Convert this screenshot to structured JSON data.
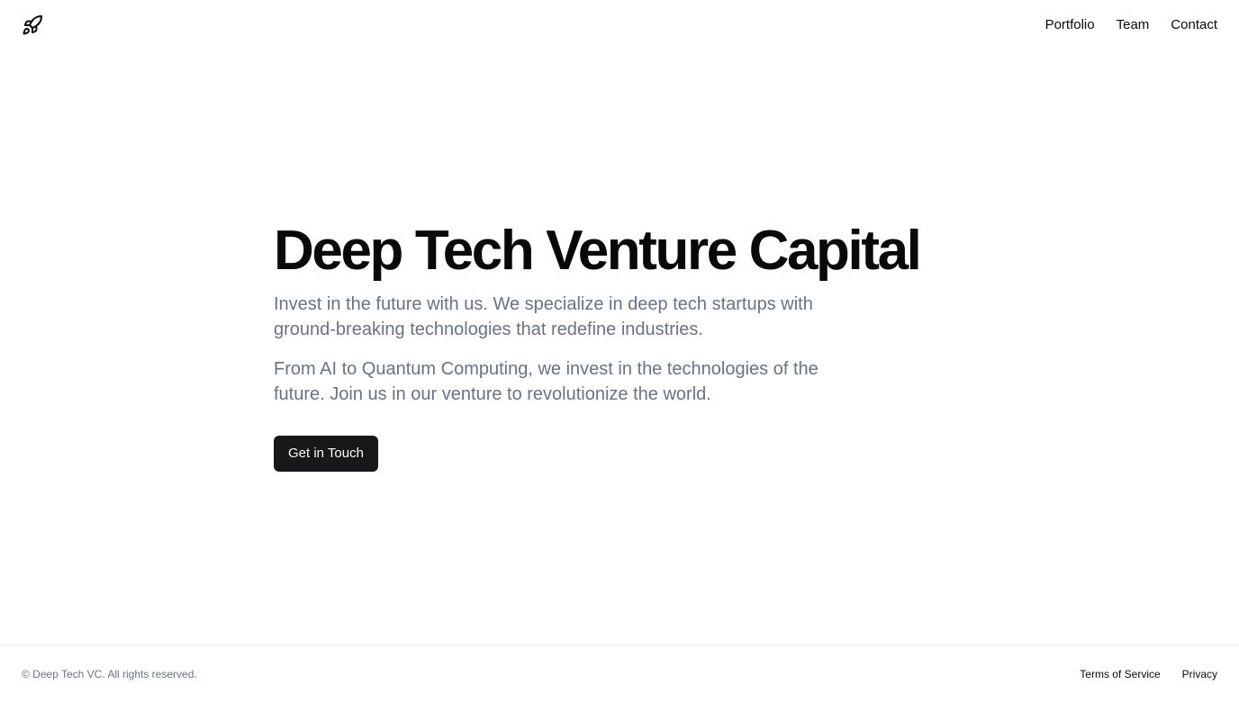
{
  "header": {
    "logo_icon": "rocket-icon",
    "nav": [
      {
        "label": "Portfolio"
      },
      {
        "label": "Team"
      },
      {
        "label": "Contact"
      }
    ]
  },
  "hero": {
    "title": "Deep Tech Venture Capital",
    "paragraph1": "Invest in the future with us. We specialize in deep tech startups with ground-breaking technologies that redefine industries.",
    "paragraph2": "From AI to Quantum Computing, we invest in the technologies of the future. Join us in our venture to revolutionize the world.",
    "cta_label": "Get in Touch"
  },
  "footer": {
    "copyright": "© Deep Tech VC. All rights reserved.",
    "links": [
      {
        "label": "Terms of Service"
      },
      {
        "label": "Privacy"
      }
    ]
  },
  "colors": {
    "text": "#09090b",
    "muted": "#6b7280",
    "button_bg": "#18181b",
    "button_text": "#fafafa",
    "border": "#e5e7eb"
  }
}
